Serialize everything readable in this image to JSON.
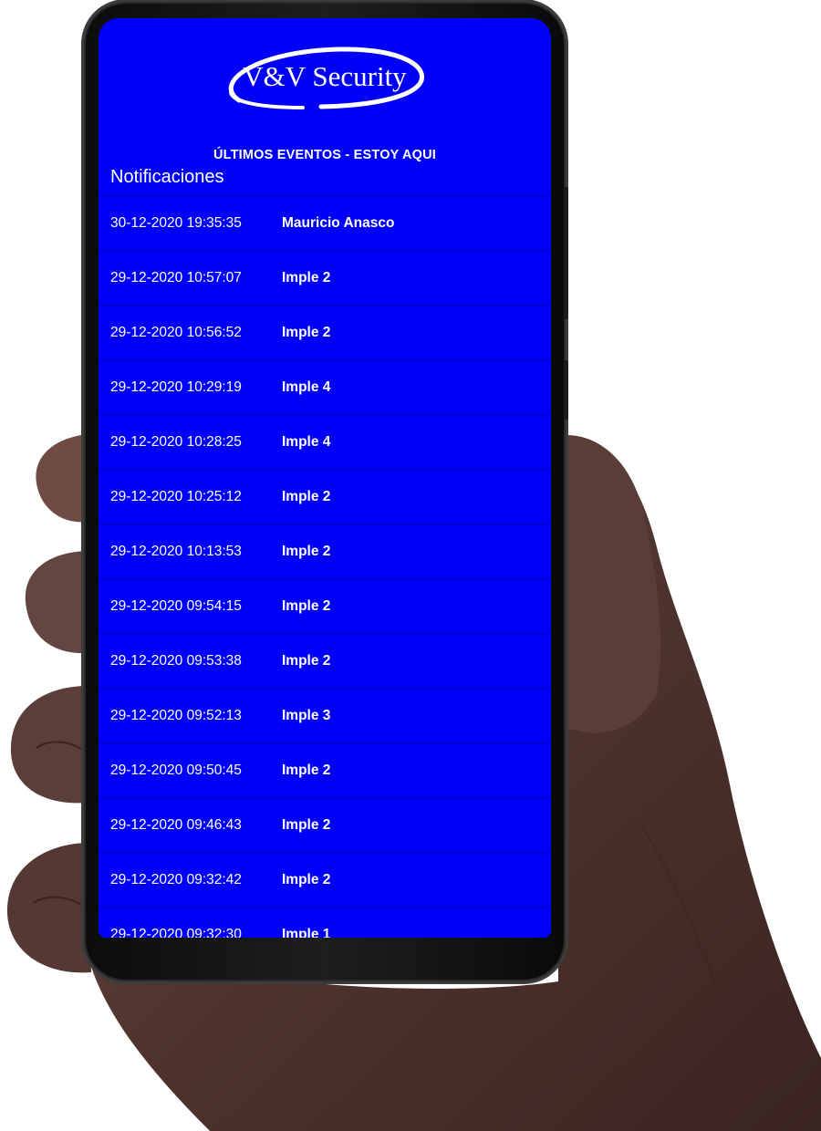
{
  "app": {
    "logo_text": "V&V Security",
    "section_title": "ÚLTIMOS EVENTOS - ESTOY AQUI",
    "list_heading": "Notificaciones"
  },
  "colors": {
    "screen_background": "#0000f8",
    "row_divider": "#0000b4",
    "text": "#ffffff"
  },
  "events": [
    {
      "datetime": "30-12-2020 19:35:35",
      "name": "Mauricio Anasco"
    },
    {
      "datetime": "29-12-2020 10:57:07",
      "name": "Imple 2"
    },
    {
      "datetime": "29-12-2020 10:56:52",
      "name": "Imple 2"
    },
    {
      "datetime": "29-12-2020 10:29:19",
      "name": "Imple 4"
    },
    {
      "datetime": "29-12-2020 10:28:25",
      "name": "Imple 4"
    },
    {
      "datetime": "29-12-2020 10:25:12",
      "name": "Imple 2"
    },
    {
      "datetime": "29-12-2020 10:13:53",
      "name": "Imple 2"
    },
    {
      "datetime": "29-12-2020 09:54:15",
      "name": "Imple 2"
    },
    {
      "datetime": "29-12-2020 09:53:38",
      "name": "Imple 2"
    },
    {
      "datetime": "29-12-2020 09:52:13",
      "name": "Imple 3"
    },
    {
      "datetime": "29-12-2020 09:50:45",
      "name": "Imple 2"
    },
    {
      "datetime": "29-12-2020 09:46:43",
      "name": "Imple 2"
    },
    {
      "datetime": "29-12-2020 09:32:42",
      "name": "Imple 2"
    },
    {
      "datetime": "29-12-2020 09:32:30",
      "name": "Imple 1"
    }
  ]
}
